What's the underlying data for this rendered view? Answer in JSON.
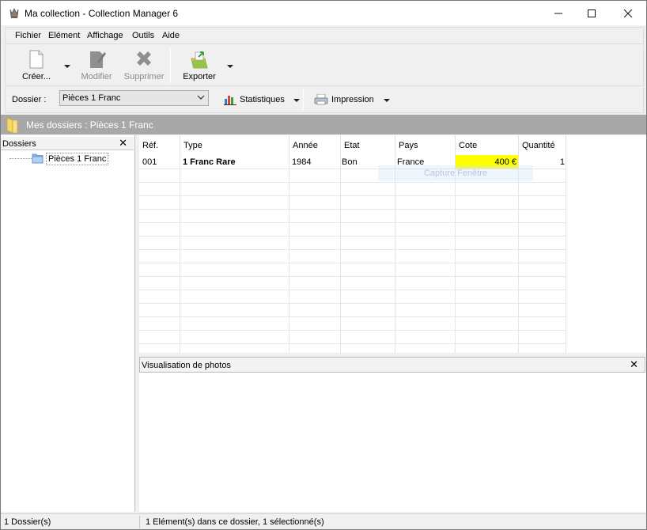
{
  "window": {
    "title": "Ma collection - Collection Manager 6",
    "minimize_glyph": "—",
    "maximize_glyph": "☐",
    "close_glyph": "✕"
  },
  "menu": {
    "items": [
      {
        "label": "Fichier"
      },
      {
        "label": "Elément"
      },
      {
        "label": "Affichage"
      },
      {
        "label": "Outils"
      },
      {
        "label": "Aide"
      }
    ]
  },
  "toolbar": {
    "create_label": "Créer...",
    "modify_label": "Modifier",
    "delete_label": "Supprimer",
    "export_label": "Exporter"
  },
  "folderbar": {
    "label": "Dossier :",
    "selected": "Pièces 1 Franc",
    "statistics_label": "Statistiques",
    "print_label": "Impression"
  },
  "header_strip": {
    "text": "Mes dossiers :  Pièces 1 Franc"
  },
  "left_pane": {
    "title": "Dossiers",
    "close_glyph": "✕",
    "tree": [
      {
        "label": "Pièces 1 Franc"
      }
    ]
  },
  "grid": {
    "columns": [
      "Réf.",
      "Type",
      "Année",
      "Etat",
      "Pays",
      "Cote",
      "Quantité"
    ],
    "rows": [
      {
        "ref": "001",
        "type": "1 Franc Rare",
        "annee": "1984",
        "etat": "Bon",
        "pays": "France",
        "cote": "400 €",
        "quantite": "1"
      }
    ],
    "highlight_color": "#ffff00",
    "watermark": "Capture Fenêtre"
  },
  "photo_pane": {
    "title": "Visualisation de photos",
    "close_glyph": "✕"
  },
  "statusbar": {
    "left": "1 Dossier(s)",
    "right": "1 Elément(s) dans ce dossier, 1 sélectionné(s)"
  },
  "colors": {
    "header_strip_bg": "#a8a8a8",
    "folder_yellow": "#f5d66a"
  }
}
